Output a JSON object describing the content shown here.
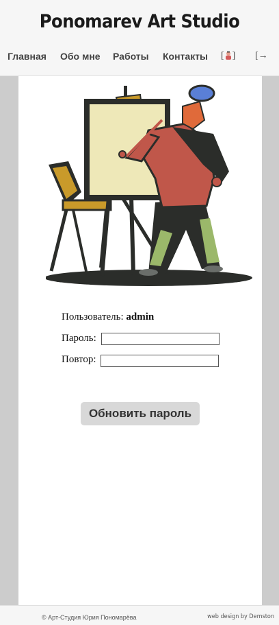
{
  "header": {
    "title": "Ponomarev Art Studio",
    "nav": [
      {
        "label": "Главная"
      },
      {
        "label": "Обо мне"
      },
      {
        "label": "Работы"
      },
      {
        "label": "Контакты"
      }
    ],
    "user_bracket_open": "[",
    "user_bracket_close": "]",
    "logout_label": "[→"
  },
  "form": {
    "user_label": "Пользователь:",
    "username": "admin",
    "password_label": "Пароль:",
    "password_value": "",
    "repeat_label": "Повтор:",
    "repeat_value": "",
    "submit_label": "Обновить пароль"
  },
  "footer": {
    "copyright": "© Арт-Студия Юрия Пономарёва",
    "credit": "web design by Demston"
  },
  "colors": {
    "side_gray": "#cccccc",
    "button_bg": "#d8d8d8",
    "painter_shirt": "#c0574a",
    "painter_pants": "#9bb86a",
    "canvas": "#eee8b8",
    "easel_gold": "#c99a2a"
  }
}
